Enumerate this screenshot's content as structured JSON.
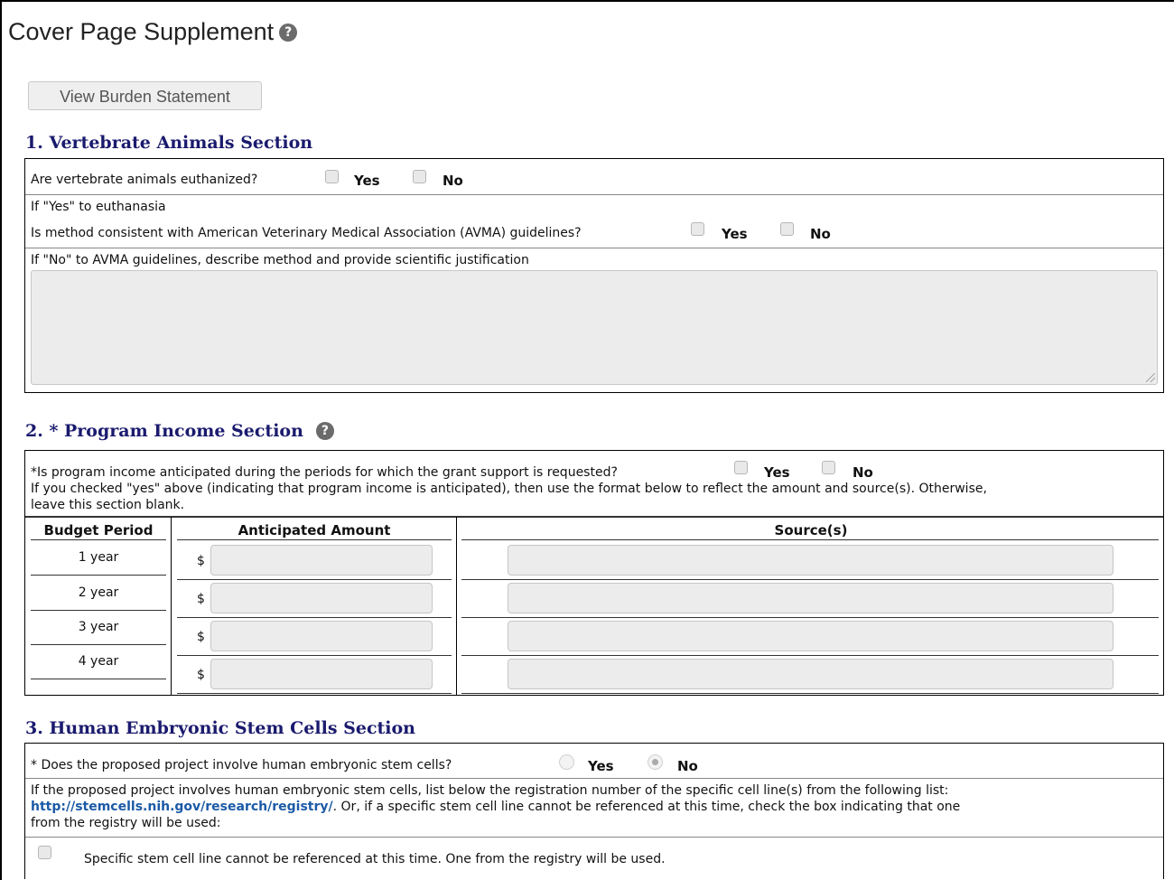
{
  "page": {
    "title": "Cover Page Supplement",
    "burden_button": "View Burden Statement"
  },
  "section1": {
    "title": "1. Vertebrate Animals Section",
    "q1": "Are vertebrate animals euthanized?",
    "if_yes": "If \"Yes\" to euthanasia",
    "q2": "Is method consistent with American Veterinary Medical Association (AVMA) guidelines?",
    "if_no": "If \"No\" to AVMA guidelines, describe method and provide scientific justification",
    "justification_value": ""
  },
  "section2": {
    "title": "2. * Program Income Section",
    "q": "*Is program income anticipated during the periods for which the grant support is requested?",
    "instr_line1": "If you checked \"yes\" above (indicating that program income is anticipated), then use the format below to reflect the amount and source(s). Otherwise,",
    "instr_line2": "leave this section blank.",
    "columns": [
      "Budget Period",
      "Anticipated Amount",
      "Source(s)"
    ],
    "currency": "$",
    "rows": [
      {
        "period": "1 year",
        "amount": "",
        "source": ""
      },
      {
        "period": "2 year",
        "amount": "",
        "source": ""
      },
      {
        "period": "3 year",
        "amount": "",
        "source": ""
      },
      {
        "period": "4 year",
        "amount": "",
        "source": ""
      }
    ]
  },
  "section3": {
    "title": "3. Human Embryonic Stem Cells Section",
    "q": "* Does the proposed project involve human embryonic stem cells?",
    "selected": "No",
    "instr_line1": "If the proposed project involves human embryonic stem cells, list below the registration number of the specific cell line(s) from the following list:",
    "link": "http://stemcells.nih.gov/research/registry/",
    "instr_line2_rest": ". Or, if a specific stem cell line cannot be referenced at this time, check the box indicating that one",
    "instr_line3": "from the registry will be used:",
    "checkbox_label": "Specific stem cell line cannot be referenced at this time. One from the registry will be used."
  },
  "labels": {
    "yes": "Yes",
    "no": "No"
  }
}
